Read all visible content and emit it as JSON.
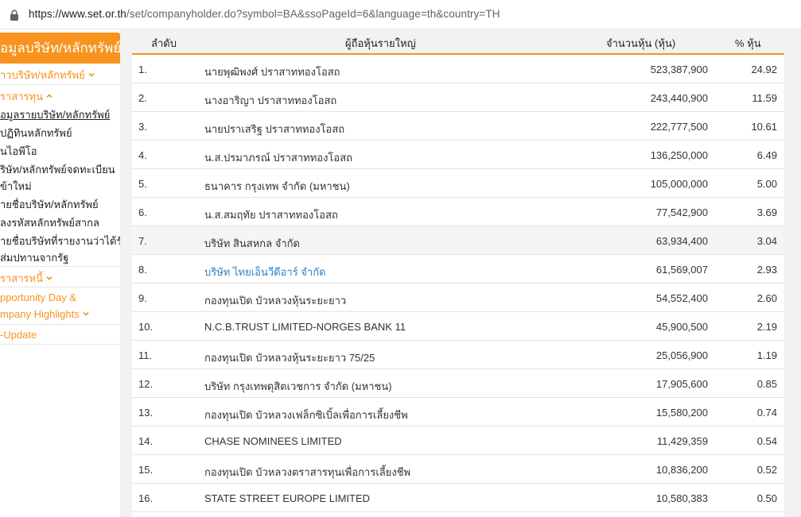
{
  "browser": {
    "url_host": "https://www.set.or.th",
    "url_path": "/set/companyholder.do?symbol=BA&ssoPageId=6&language=th&country=TH"
  },
  "sidebar": {
    "header": "อมูลบริษัท/หลักทรัพย์",
    "items": [
      {
        "label": "าวบริษัท/หลักทรัพย์",
        "style": "orange",
        "chevron": "down"
      },
      {
        "label": "ราสารทุน",
        "style": "orange",
        "chevron": "up"
      },
      {
        "label": "อมูลรายบริษัท/หลักทรัพย์",
        "style": "dark-underline"
      },
      {
        "label": "ปฏิทินหลักทรัพย์",
        "style": "dark"
      },
      {
        "label": "นไอพีโอ",
        "style": "dark"
      },
      {
        "label": "ริษัท/หลักทรัพย์จดทะเบียน",
        "style": "dark"
      },
      {
        "label": "ข้าใหม่",
        "style": "dark"
      },
      {
        "label": "ายชื่อบริษัท/หลักทรัพย์",
        "style": "dark"
      },
      {
        "label": "ลงรหัสหลักทรัพย์สากล",
        "style": "dark"
      },
      {
        "label": "ายชื่อบริษัทที่รายงานว่าได้รับ",
        "style": "dark"
      },
      {
        "label": "ส่มปทานจากรัฐ",
        "style": "dark"
      },
      {
        "label": "ราสารหนี้",
        "style": "orange",
        "chevron": "down"
      },
      {
        "label": "pportunity Day &",
        "style": "orange"
      },
      {
        "label": "mpany Highlights",
        "style": "orange",
        "chevron": "down"
      },
      {
        "label": "-Update",
        "style": "orange"
      }
    ]
  },
  "table": {
    "headers": {
      "no": "ลำดับ",
      "name": "ผู้ถือหุ้นรายใหญ่",
      "shares": "จำนวนหุ้น (หุ้น)",
      "pct": "% หุ้น"
    },
    "rows": [
      {
        "no": "1.",
        "name": "นายพุฒิพงศ์ ปราสาททองโอสถ",
        "shares": "523,387,900",
        "pct": "24.92"
      },
      {
        "no": "2.",
        "name": "นางอาริญา ปราสาททองโอสถ",
        "shares": "243,440,900",
        "pct": "11.59"
      },
      {
        "no": "3.",
        "name": "นายปราเสริฐ ปราสาททองโอสถ",
        "shares": "222,777,500",
        "pct": "10.61"
      },
      {
        "no": "4.",
        "name": "น.ส.ปรมาภรณ์ ปราสาททองโอสถ",
        "shares": "136,250,000",
        "pct": "6.49"
      },
      {
        "no": "5.",
        "name": "ธนาคาร กรุงเทพ จำกัด (มหาชน)",
        "shares": "105,000,000",
        "pct": "5.00"
      },
      {
        "no": "6.",
        "name": "น.ส.สมฤทัย ปราสาททองโอสถ",
        "shares": "77,542,900",
        "pct": "3.69"
      },
      {
        "no": "7.",
        "name": "บริษัท สินสหกล จำกัด",
        "shares": "63,934,400",
        "pct": "3.04"
      },
      {
        "no": "8.",
        "name": "บริษัท ไทยเอ็นวีดีอาร์ จำกัด",
        "shares": "61,569,007",
        "pct": "2.93"
      },
      {
        "no": "9.",
        "name": "กองทุนเปิด บัวหลวงหุ้นระยะยาว",
        "shares": "54,552,400",
        "pct": "2.60"
      },
      {
        "no": "10.",
        "name": "N.C.B.TRUST LIMITED-NORGES BANK 11",
        "shares": "45,900,500",
        "pct": "2.19"
      },
      {
        "no": "11.",
        "name": "กองทุนเปิด บัวหลวงหุ้นระยะยาว 75/25",
        "shares": "25,056,900",
        "pct": "1.19"
      },
      {
        "no": "12.",
        "name": "บริษัท กรุงเทพดุสิตเวชการ จำกัด (มหาชน)",
        "shares": "17,905,600",
        "pct": "0.85"
      },
      {
        "no": "13.",
        "name": "กองทุนเปิด บัวหลวงเฟล็กซิเบิ้ลเพื่อการเลี้ยงชีพ",
        "shares": "15,580,200",
        "pct": "0.74"
      },
      {
        "no": "14.",
        "name": "CHASE NOMINEES LIMITED",
        "shares": "11,429,359",
        "pct": "0.54"
      },
      {
        "no": "15.",
        "name": "กองทุนเปิด บัวหลวงตราสารทุนเพื่อการเลี้ยงชีพ",
        "shares": "10,836,200",
        "pct": "0.52"
      },
      {
        "no": "16.",
        "name": "STATE STREET EUROPE LIMITED",
        "shares": "10,580,383",
        "pct": "0.50"
      }
    ]
  },
  "colors": {
    "accent": "#f7931e",
    "link": "#2f7fc1",
    "header_bg": "#f2f2f2"
  }
}
